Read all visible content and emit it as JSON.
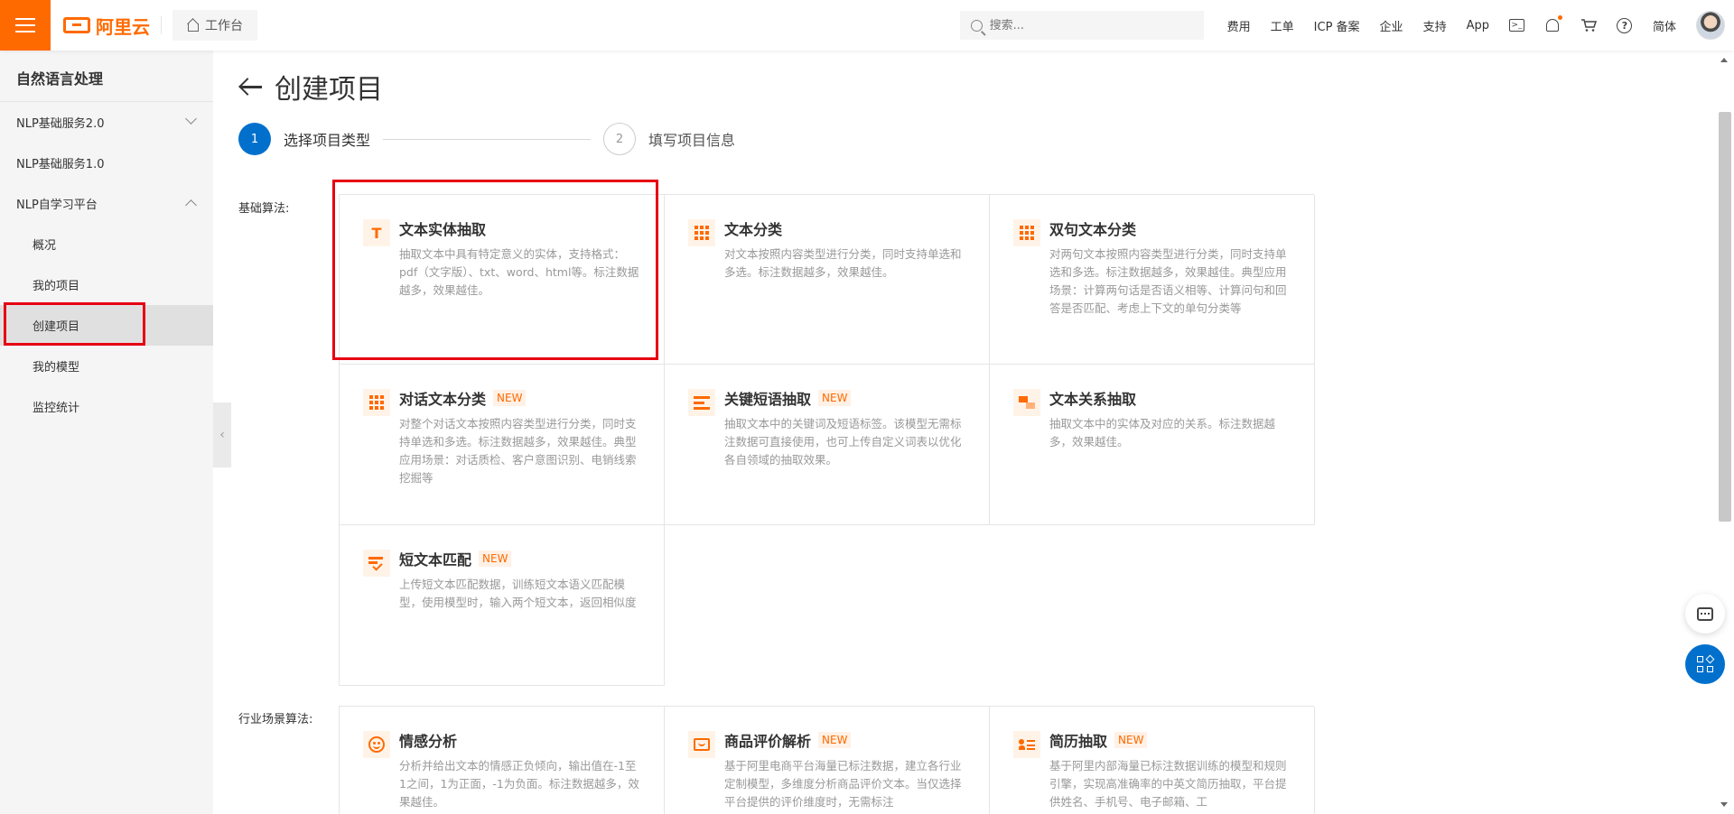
{
  "header": {
    "brand": "阿里云",
    "workbench": "工作台",
    "search_placeholder": "搜索...",
    "links": [
      "费用",
      "工单",
      "ICP 备案",
      "企业",
      "支持",
      "App"
    ],
    "language": "简体",
    "icons": [
      "terminal-icon",
      "bell-icon",
      "cart-icon",
      "help-icon"
    ]
  },
  "sidebar": {
    "title": "自然语言处理",
    "items": [
      {
        "label": "NLP基础服务2.0"
      },
      {
        "label": "NLP基础服务1.0"
      },
      {
        "label": "NLP自学习平台"
      },
      {
        "label": "概况"
      },
      {
        "label": "我的项目"
      },
      {
        "label": "创建项目"
      },
      {
        "label": "我的模型"
      },
      {
        "label": "监控统计"
      }
    ]
  },
  "page": {
    "title": "创建项目",
    "steps": [
      {
        "number": "1",
        "label": "选择项目类型"
      },
      {
        "number": "2",
        "label": "填写项目信息"
      }
    ],
    "sections": [
      {
        "label": "基础算法:",
        "cards": [
          {
            "title": "文本实体抽取",
            "badge": "",
            "desc": "抽取文本中具有特定意义的实体，支持格式：pdf（文字版）、txt、word、html等。标注数据越多，效果越佳。"
          },
          {
            "title": "文本分类",
            "badge": "",
            "desc": "对文本按照内容类型进行分类，同时支持单选和多选。标注数据越多，效果越佳。"
          },
          {
            "title": "双句文本分类",
            "badge": "",
            "desc": "对两句文本按照内容类型进行分类，同时支持单选和多选。标注数据越多，效果越佳。典型应用场景：计算两句话是否语义相等、计算问句和回答是否匹配、考虑上下文的单句分类等"
          },
          {
            "title": "对话文本分类",
            "badge": "NEW",
            "desc": "对整个对话文本按照内容类型进行分类，同时支持单选和多选。标注数据越多，效果越佳。典型应用场景：对话质检、客户意图识别、电销线索挖掘等"
          },
          {
            "title": "关键短语抽取",
            "badge": "NEW",
            "desc": "抽取文本中的关键词及短语标签。该模型无需标注数据可直接使用，也可上传自定义词表以优化各自领域的抽取效果。"
          },
          {
            "title": "文本关系抽取",
            "badge": "",
            "desc": "抽取文本中的实体及对应的关系。标注数据越多，效果越佳。"
          },
          {
            "title": "短文本匹配",
            "badge": "NEW",
            "desc": "上传短文本匹配数据，训练短文本语义匹配模型，使用模型时，输入两个短文本，返回相似度"
          }
        ]
      },
      {
        "label": "行业场景算法:",
        "cards": [
          {
            "title": "情感分析",
            "badge": "",
            "desc": "分析并给出文本的情感正负倾向，输出值在-1至1之间，1为正面，-1为负面。标注数据越多，效果越佳。"
          },
          {
            "title": "商品评价解析",
            "badge": "NEW",
            "desc": "基于阿里电商平台海量已标注数据，建立各行业定制模型，多维度分析商品评价文本。当仅选择平台提供的评价维度时，无需标注"
          },
          {
            "title": "简历抽取",
            "badge": "NEW",
            "desc": "基于阿里内部海量已标注数据训练的模型和规则引擎，实现高准确率的中英文简历抽取，平台提供姓名、手机号、电子邮箱、工"
          }
        ]
      }
    ]
  },
  "colors": {
    "accent": "#ff6a00",
    "primary": "#0070cc",
    "highlight": "#e60012"
  }
}
